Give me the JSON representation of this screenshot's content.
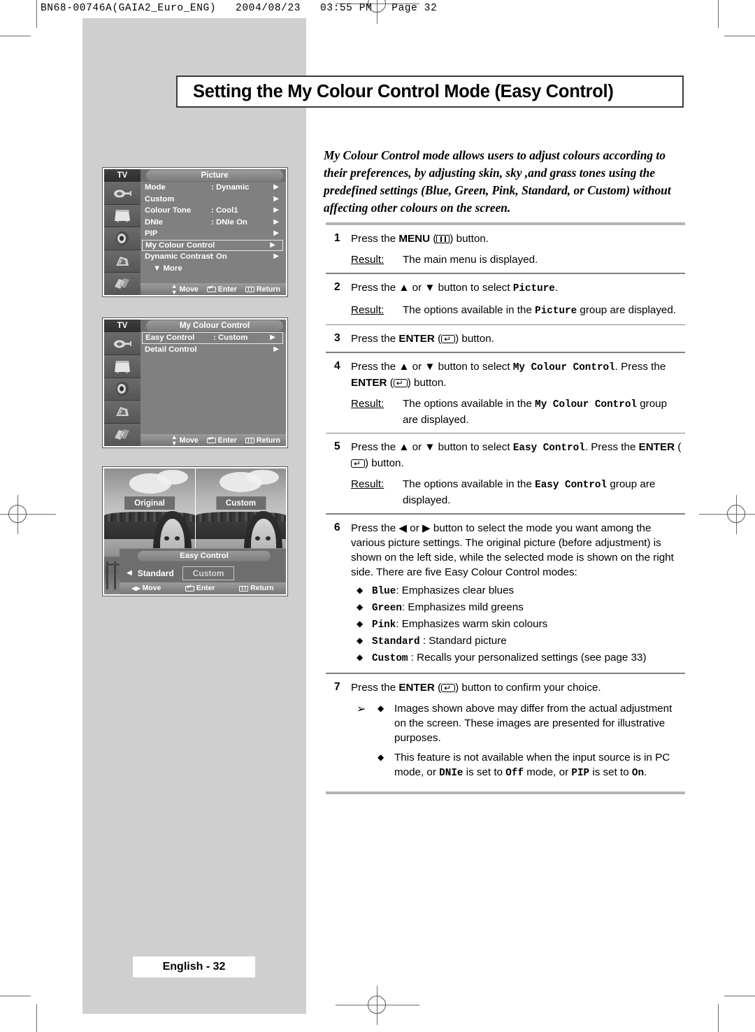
{
  "print_header": "BN68-00746A(GAIA2_Euro_ENG)   2004/08/23   03:55 PM   Page 32",
  "title": "Setting the My Colour Control Mode (Easy Control)",
  "intro": "My Colour Control mode allows users to adjust colours according to their preferences, by adjusting skin, sky ,and grass tones using the predefined settings (Blue, Green, Pink, Standard, or Custom) without affecting other colours on the screen.",
  "steps": {
    "s1_num": "1",
    "s1_a": "Press the ",
    "s1_menu": "MENU",
    "s1_b": " (",
    "s1_c": ") button.",
    "s1_result_label": "Result:",
    "s1_result_text": "The main menu is displayed.",
    "s2_num": "2",
    "s2_a": "Press the ▲ or ▼ button to select ",
    "s2_target": "Picture",
    "s2_b": ".",
    "s2_result_label": "Result:",
    "s2_result_a": "The options available in the ",
    "s2_result_target": "Picture",
    "s2_result_b": " group are displayed.",
    "s3_num": "3",
    "s3_a": "Press the ",
    "s3_enter": "ENTER",
    "s3_b": " (",
    "s3_c": ") button.",
    "s4_num": "4",
    "s4_a": "Press the ▲ or ▼ button to select ",
    "s4_target": "My Colour Control",
    "s4_b": ". Press the ",
    "s4_enter": "ENTER",
    "s4_c": " (",
    "s4_d": ") button.",
    "s4_result_label": "Result:",
    "s4_result_a": "The options available in the ",
    "s4_result_target": "My Colour Control",
    "s4_result_b": " group are displayed.",
    "s5_num": "5",
    "s5_a": "Press the ▲ or ▼ button to select ",
    "s5_target": "Easy Control",
    "s5_b": ". Press the ",
    "s5_enter": "ENTER",
    "s5_c": " (",
    "s5_d": ") button.",
    "s5_result_label": "Result:",
    "s5_result_a": "The options available in the ",
    "s5_result_target": "Easy Control",
    "s5_result_b": " group are displayed.",
    "s6_num": "6",
    "s6_text": "Press the ◀ or ▶ button to select the mode you want among the various picture settings. The original picture (before adjustment) is shown on the left side, while the selected mode is shown on the right side. There are five Easy Colour Control modes:",
    "s6_bullets": [
      {
        "diamond": "◆",
        "mode": "Blue",
        "desc": ":  Emphasizes clear blues"
      },
      {
        "diamond": "◆",
        "mode": "Green",
        "desc": ": Emphasizes mild greens"
      },
      {
        "diamond": "◆",
        "mode": "Pink",
        "desc": ":  Emphasizes warm skin colours"
      },
      {
        "diamond": "◆",
        "mode": "Standard",
        "desc": " : Standard picture"
      },
      {
        "diamond": "◆",
        "mode": "Custom",
        "desc": " : Recalls your personalized settings (see page 33)"
      }
    ],
    "s7_num": "7",
    "s7_a": "Press the ",
    "s7_enter": "ENTER",
    "s7_b": " (",
    "s7_c": ")  button to confirm your choice.",
    "note_arrow": "➢",
    "notes": [
      {
        "diamond": "◆",
        "text": "Images shown above may differ from the actual adjustment on the screen. These images are presented for illustrative purposes."
      }
    ],
    "note2_diamond": "◆",
    "note2_a": "This feature is not available when the input source is in PC mode, or ",
    "note2_dnie": "DNIe",
    "note2_b": " is set to ",
    "note2_off": "Off",
    "note2_c": " mode, or ",
    "note2_pip": "PIP",
    "note2_d": " is set to ",
    "note2_on": "On",
    "note2_e": "."
  },
  "osd1": {
    "source": "TV",
    "caption": "Picture",
    "items": [
      {
        "label": "Mode",
        "value": ": Dynamic",
        "arrow": "▶",
        "selected": false
      },
      {
        "label": "Custom",
        "value": "",
        "arrow": "▶",
        "selected": false
      },
      {
        "label": "Colour Tone",
        "value": ": Cool1",
        "arrow": "▶",
        "selected": false
      },
      {
        "label": "DNIe",
        "value": ": DNIe On",
        "arrow": "▶",
        "selected": false
      },
      {
        "label": "PIP",
        "value": "",
        "arrow": "▶",
        "selected": false
      },
      {
        "label": "My Colour Control",
        "value": "",
        "arrow": "▶",
        "selected": true
      },
      {
        "label": "Dynamic Contrast",
        "value": ": On",
        "arrow": "▶",
        "selected": false
      }
    ],
    "more": "▼ More",
    "footer": {
      "move": "Move",
      "enter": "Enter",
      "return": "Return"
    }
  },
  "osd2": {
    "source": "TV",
    "caption": "My Colour Control",
    "items": [
      {
        "label": "Easy Control",
        "value": ": Custom",
        "arrow": "▶",
        "selected": true
      },
      {
        "label": "Detail Control",
        "value": "",
        "arrow": "▶",
        "selected": false
      }
    ],
    "footer": {
      "move": "Move",
      "enter": "Enter",
      "return": "Return"
    }
  },
  "osd3": {
    "tag_left": "Original",
    "tag_right": "Custom",
    "ec_title": "Easy Control",
    "ec_left_arrow": "◀",
    "ec_standard": "Standard",
    "ec_custom": "Custom",
    "footer": {
      "move": "Move",
      "enter": "Enter",
      "return": "Return",
      "move_glyph": "◀▶"
    }
  },
  "page_footer": "English - 32"
}
